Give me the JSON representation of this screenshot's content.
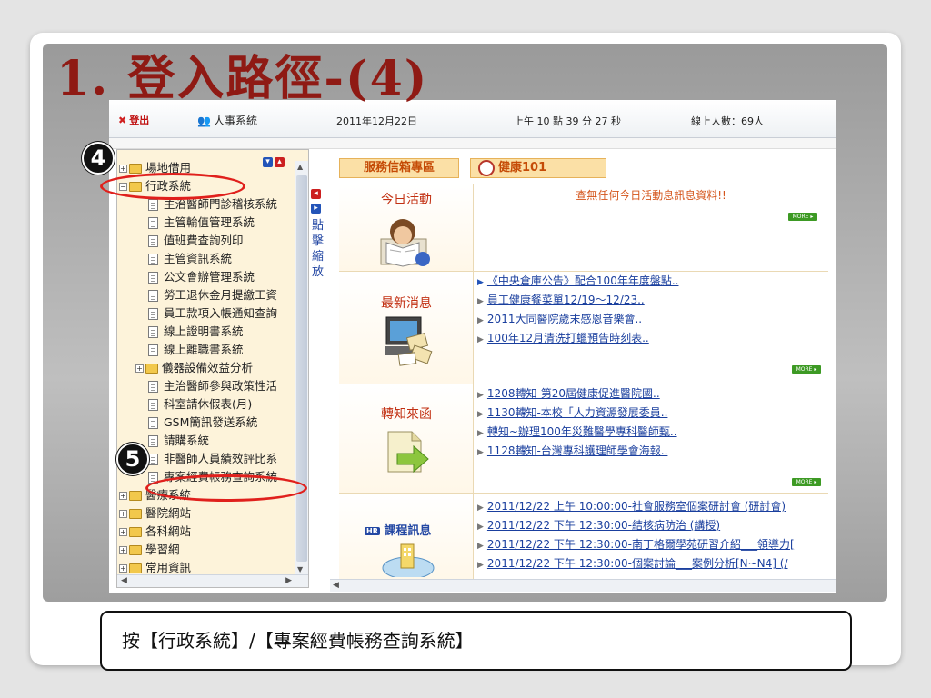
{
  "slide_title": "1. 登入路徑-(4)",
  "header": {
    "logout": "登出",
    "system": "人事系統",
    "date": "2011年12月22日",
    "time": "上午 10 點 39 分 27 秒",
    "online": "線上人數：69人"
  },
  "tree": {
    "nodes": [
      {
        "label": "場地借用",
        "type": "folder",
        "exp": "+",
        "indent": 0
      },
      {
        "label": "行政系統",
        "type": "folder",
        "exp": "−",
        "indent": 0
      },
      {
        "label": "主治醫師門診稽核系統",
        "type": "doc",
        "indent": 1
      },
      {
        "label": "主管輪值管理系統",
        "type": "doc",
        "indent": 1
      },
      {
        "label": "值班費查詢列印",
        "type": "doc",
        "indent": 1
      },
      {
        "label": "主管資訊系統",
        "type": "doc",
        "indent": 1
      },
      {
        "label": "公文會辦管理系統",
        "type": "doc",
        "indent": 1
      },
      {
        "label": "勞工退休金月提繳工資",
        "type": "doc",
        "indent": 1
      },
      {
        "label": "員工款項入帳通知查詢",
        "type": "doc",
        "indent": 1
      },
      {
        "label": "線上證明書系統",
        "type": "doc",
        "indent": 1
      },
      {
        "label": "線上離職書系統",
        "type": "doc",
        "indent": 1
      },
      {
        "label": "儀器設備效益分析",
        "type": "folder",
        "exp": "+",
        "indent": 1
      },
      {
        "label": "主治醫師參與政策性活",
        "type": "doc",
        "indent": 1
      },
      {
        "label": "科室請休假表(月)",
        "type": "doc",
        "indent": 1
      },
      {
        "label": "GSM簡訊發送系統",
        "type": "doc",
        "indent": 1
      },
      {
        "label": "請購系統",
        "type": "doc",
        "indent": 1
      },
      {
        "label": "非醫師人員績效評比系",
        "type": "doc",
        "indent": 1
      },
      {
        "label": "專案經費帳務查詢系統",
        "type": "doc",
        "indent": 1
      },
      {
        "label": "醫療系統",
        "type": "folder",
        "exp": "+",
        "indent": 0
      },
      {
        "label": "醫院網站",
        "type": "folder",
        "exp": "+",
        "indent": 0
      },
      {
        "label": "各科網站",
        "type": "folder",
        "exp": "+",
        "indent": 0
      },
      {
        "label": "學習網",
        "type": "folder",
        "exp": "+",
        "indent": 0
      },
      {
        "label": "常用資訊",
        "type": "folder",
        "exp": "+",
        "indent": 0
      }
    ]
  },
  "sidebar_hint": "點擊縮放",
  "banner": {
    "left": "服務信箱專區",
    "right": "健康101"
  },
  "sections": {
    "today": {
      "title": "今日活動",
      "notice": "查無任何今日活動息訊息資料!!",
      "more": "MORE ▸"
    },
    "news": {
      "title": "最新消息",
      "items": [
        "《中央倉庫公告》配合100年年度盤點..",
        "員工健康餐菜單12/19～12/23..",
        "2011大同醫院歲末感恩音樂會..",
        "100年12月清洗打蠟預告時刻表.."
      ],
      "more": "MORE ▸"
    },
    "letters": {
      "title": "轉知來函",
      "items": [
        "1208轉知-第20屆健康促進醫院國..",
        "1130轉知-本校「人力資源發展委員..",
        "轉知~辦理100年災難醫學專科醫師甄..",
        "1128轉知-台灣專科護理師學會海報.."
      ],
      "more": "MORE ▸"
    },
    "courses": {
      "title": "課程訊息",
      "badge": "HR",
      "items": [
        "2011/12/22 上午 10:00:00-社會服務室個案研討會 (研討會)",
        "2011/12/22 下午 12:30:00-結核病防治 (講授)",
        "2011/12/22 下午 12:30:00-南丁格爾學苑研習介紹___領導力[",
        "2011/12/22 下午 12:30:00-個案討論___案例分析[N~N4] (/"
      ]
    }
  },
  "steps": {
    "four": "4",
    "five": "5"
  },
  "caption": "按【行政系統】/【專案經費帳務查詢系統】",
  "colors": {
    "title": "#8f1a14",
    "highlight": "#e0201c",
    "tree_bg": "#fdf3da"
  }
}
